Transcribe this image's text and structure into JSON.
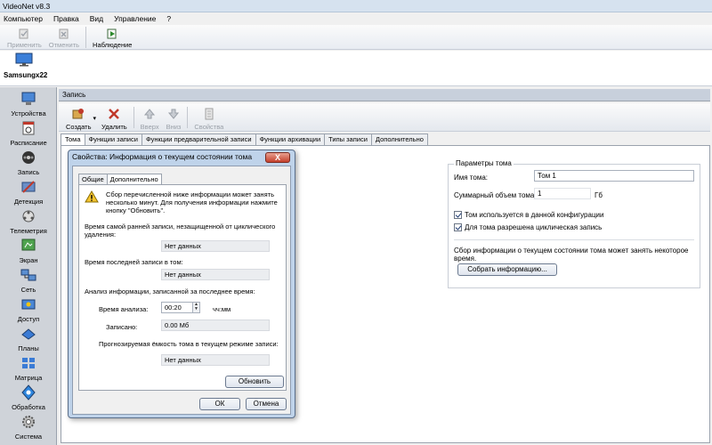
{
  "window": {
    "title": "VideoNet v8.3"
  },
  "menu": [
    "Компьютер",
    "Правка",
    "Вид",
    "Управление",
    "?"
  ],
  "toolbar": {
    "apply": "Применить",
    "cancel": "Отменить",
    "watch": "Наблюдение"
  },
  "device": {
    "name": "Samsungx22"
  },
  "sidebar": [
    {
      "label": "Устройства",
      "icon": "devices-icon"
    },
    {
      "label": "Расписание",
      "icon": "schedule-icon"
    },
    {
      "label": "Запись",
      "icon": "record-icon"
    },
    {
      "label": "Детекция",
      "icon": "detection-icon"
    },
    {
      "label": "Телеметрия",
      "icon": "telemetry-icon"
    },
    {
      "label": "Экран",
      "icon": "screen-icon"
    },
    {
      "label": "Сеть",
      "icon": "network-icon"
    },
    {
      "label": "Доступ",
      "icon": "access-icon"
    },
    {
      "label": "Планы",
      "icon": "plans-icon"
    },
    {
      "label": "Матрица",
      "icon": "matrix-icon"
    },
    {
      "label": "Обработка",
      "icon": "processing-icon"
    },
    {
      "label": "Система",
      "icon": "system-icon"
    }
  ],
  "panel": {
    "title": "Запись",
    "create": "Создать",
    "delete": "Удалить",
    "up": "Вверх",
    "down": "Вниз",
    "properties": "Свойства"
  },
  "tabs": [
    "Тома",
    "Функции записи",
    "Функции предварительной записи",
    "Функции архивации",
    "Типы записи",
    "Дополнительно"
  ],
  "volume_params": {
    "title": "Параметры тома",
    "name_label": "Имя тома:",
    "name_value": "Том 1",
    "size_label": "Суммарный объем тома:",
    "size_value": "1",
    "size_unit": "Гб",
    "chk_used": "Том используется в данной конфигурации",
    "chk_cyclic": "Для тома разрешена циклическая запись",
    "collect_text": "Сбор информации о текущем состоянии тома может занять некоторое время.",
    "collect_button": "Собрать информацию..."
  },
  "dialog": {
    "title": "Свойства: Информация о текущем состоянии тома",
    "close": "X",
    "tab_general": "Общие",
    "tab_extra": "Дополнительно",
    "notice_line1": "Сбор перечисленной ниже информации может занять",
    "notice_line2": "несколько минут. Для получения информации нажмите",
    "notice_line3": "кнопку \"Обновить\".",
    "earliest_label1": "Время самой ранней записи, незащищенной от циклического",
    "earliest_label2": "удаления:",
    "earliest_value": "Нет данных",
    "last_label": "Время последней записи в том:",
    "last_value": "Нет данных",
    "analysis_label": "Анализ информации, записанной за последнее время:",
    "analysis_time_label": "Время анализа:",
    "analysis_time_value": "00:20",
    "analysis_time_unit": "чч:мм",
    "recorded_label": "Записано:",
    "recorded_value": "0.00 Мб",
    "forecast_label": "Прогнозируемая ёмкость тома в текущем режиме записи:",
    "forecast_value": "Нет данных",
    "refresh": "Обновить",
    "ok": "ОК",
    "cancel": "Отмена"
  }
}
